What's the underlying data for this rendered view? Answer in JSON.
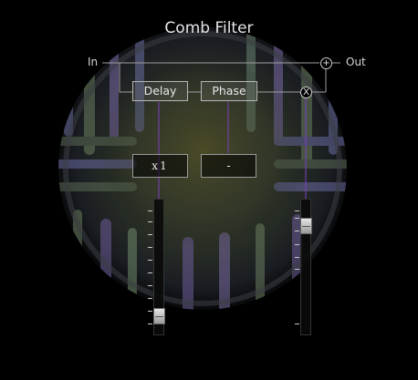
{
  "title": "Comb Filter",
  "io": {
    "in_label": "In",
    "out_label": "Out"
  },
  "blocks": {
    "delay": "Delay",
    "phase": "Phase"
  },
  "operators": {
    "sum": "+",
    "multiply": "X"
  },
  "params": {
    "delay_value": "x1",
    "phase_value": "-"
  },
  "sliders": {
    "left": {
      "level": 0.1
    },
    "right": {
      "level": 0.85
    }
  },
  "colors": {
    "accent": "#7b3fbf",
    "background": "#000000"
  }
}
